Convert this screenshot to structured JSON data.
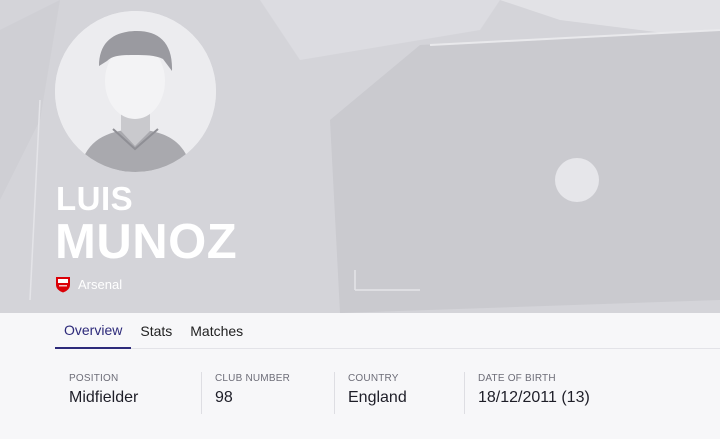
{
  "player": {
    "first_name": "LUIS",
    "last_name": "MUNOZ",
    "club": "Arsenal",
    "avatar_icon": "player-silhouette",
    "club_badge_icon": "arsenal-crest"
  },
  "tabs": [
    {
      "label": "Overview",
      "active": true
    },
    {
      "label": "Stats",
      "active": false
    },
    {
      "label": "Matches",
      "active": false
    }
  ],
  "info": [
    {
      "label": "POSITION",
      "value": "Midfielder"
    },
    {
      "label": "CLUB NUMBER",
      "value": "98"
    },
    {
      "label": "COUNTRY",
      "value": "England"
    },
    {
      "label": "DATE OF BIRTH",
      "value": "18/12/2011 (13)"
    }
  ],
  "colors": {
    "hero_bg": "#d6d6db",
    "accent": "#2d2a7a",
    "badge_red": "#db0007"
  }
}
